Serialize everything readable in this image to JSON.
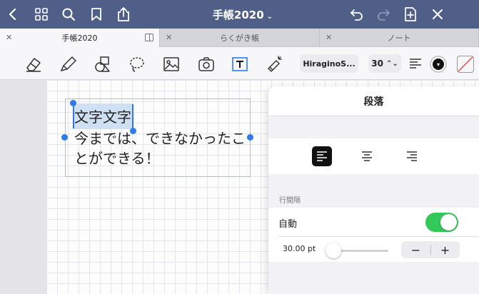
{
  "topbar": {
    "title": "手帳2020",
    "icons": [
      "back-icon",
      "grid-icon",
      "search-icon",
      "bookmark-icon",
      "share-icon",
      "undo-icon",
      "redo-icon",
      "add-page-icon",
      "close-icon"
    ]
  },
  "tabs": [
    {
      "label": "手帳2020",
      "active": true
    },
    {
      "label": "らくがき帳",
      "active": false
    },
    {
      "label": "ノート",
      "active": false
    }
  ],
  "toolbar": {
    "tools": [
      "eraser-icon",
      "highlighter-icon",
      "shapes-icon",
      "lasso-icon",
      "image-icon",
      "camera-icon",
      "text-icon",
      "laser-pointer-icon"
    ],
    "font_name": "HiraginoS...",
    "font_size": "30",
    "colors": {
      "text_color": "#111111",
      "accent": "#2f7be5"
    }
  },
  "textbox": {
    "lines": [
      "文字文字",
      "今までは、できなかったこ",
      "とができる！"
    ]
  },
  "paragraph_popover": {
    "title": "段落",
    "alignment_selected": "left",
    "line_spacing_label": "行間隔",
    "auto_label": "自動",
    "auto_enabled": true,
    "spacing_value": "30.00 pt",
    "slider_level": 0.12,
    "minus": "−",
    "plus": "+"
  }
}
